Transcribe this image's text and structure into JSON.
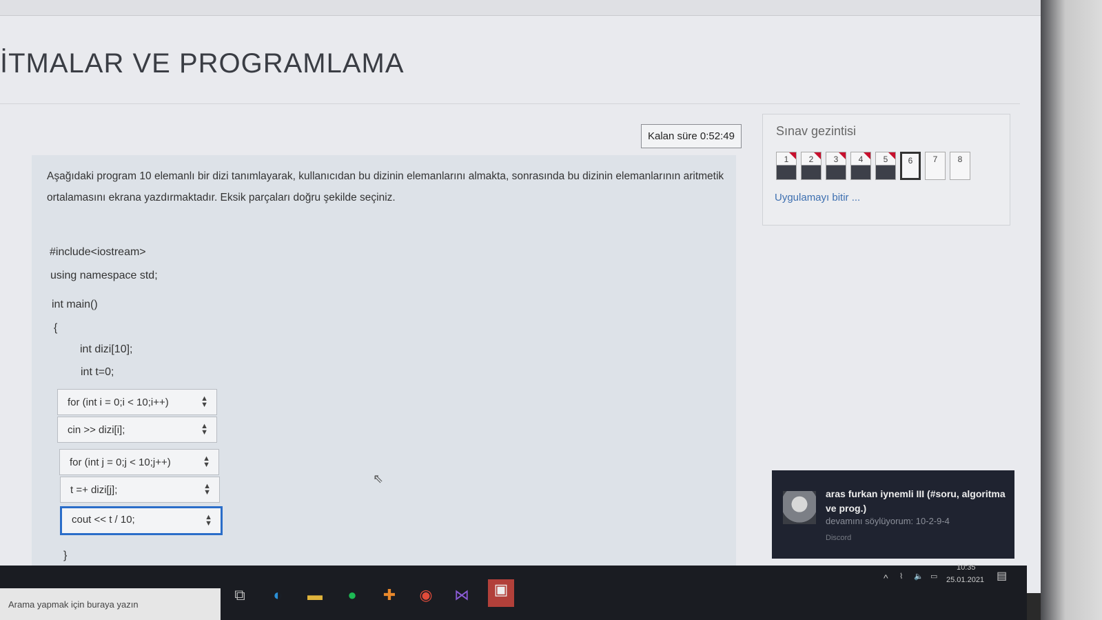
{
  "page": {
    "title": "İTMALAR VE PROGRAMLAMA"
  },
  "timer": {
    "text": "Kalan süre 0:52:49"
  },
  "question": {
    "text": "Aşağıdaki program 10 elemanlı bir dizi tanımlayarak, kullanıcıdan bu dizinin elemanlarını almakta, sonrasında bu dizinin elemanlarının aritmetik ortalamasını ekrana yazdırmaktadır. Eksik parçaları doğru şekilde seçiniz.",
    "code": {
      "include": "#include<iostream>",
      "using": "using namespace std;",
      "main": "int main()",
      "open": "{",
      "decl1": "int dizi[10];",
      "decl2": "int t=0;",
      "close": "}"
    },
    "selects": [
      {
        "value": "for (int i = 0;i < 10;i++)"
      },
      {
        "value": "cin >> dizi[i];"
      },
      {
        "value": "for (int j = 0;j < 10;j++)"
      },
      {
        "value": "t =+ dizi[j];"
      },
      {
        "value": "cout << t / 10;"
      }
    ]
  },
  "navigation": {
    "title": "Sınav gezintisi",
    "buttons": [
      {
        "label": "1",
        "state": "answered"
      },
      {
        "label": "2",
        "state": "answered"
      },
      {
        "label": "3",
        "state": "answered"
      },
      {
        "label": "4",
        "state": "answered"
      },
      {
        "label": "5",
        "state": "answered"
      },
      {
        "label": "6",
        "state": "current"
      },
      {
        "label": "7",
        "state": "unanswered"
      },
      {
        "label": "8",
        "state": "unanswered"
      }
    ],
    "finish_link": "Uygulamayı bitir ..."
  },
  "notification": {
    "title": "aras furkan iynemli III (#soru, algoritma ve prog.)",
    "message": "devamını söylüyorum: 10-2-9-4",
    "app": "Discord"
  },
  "taskbar": {
    "search_placeholder": "Arama yapmak için buraya yazın",
    "clock_time": "10:35",
    "clock_date": "25.01.2021"
  },
  "colors": {
    "accent": "#2a6dc9",
    "flag": "#c8102e",
    "link": "#3d6fb0"
  }
}
